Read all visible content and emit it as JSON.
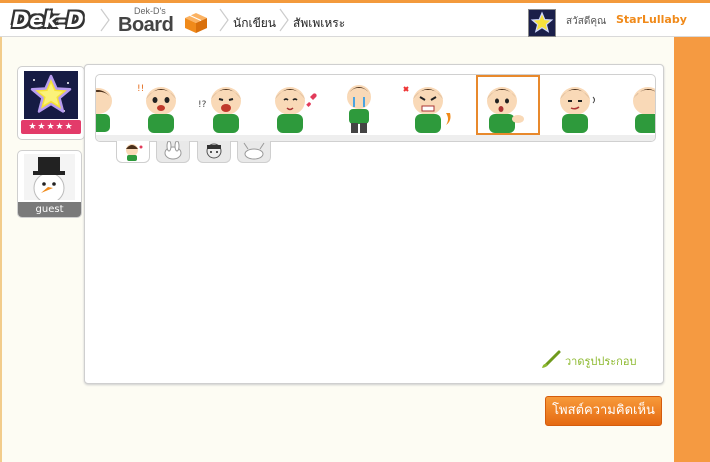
{
  "header": {
    "logo_text": "Dek-D",
    "board_logo_small": "Dek-D's",
    "board_logo_big": "Board",
    "nav_items": [
      "นักเขียน",
      "สัพเพเหระ"
    ],
    "greeting": "สวัสดีคุณ",
    "username": "StarLullaby"
  },
  "sidebar": {
    "user_stars": "★★★★★",
    "guest_label": "guest"
  },
  "editor": {
    "sticker_icons": [
      "boy-sticker-partial",
      "boy-scared-sticker",
      "boy-shouting-sticker",
      "boy-love-sticker",
      "boy-crying-sticker",
      "boy-angry-sticker",
      "boy-thinking-sticker",
      "boy-smirk-sticker",
      "boy-sticker-partial-right"
    ],
    "selected_sticker_index": 6,
    "sticker_sets": [
      "boy-set",
      "rabbit-set",
      "face-set",
      "bunny-set"
    ],
    "active_set_index": 0,
    "draw_label": "วาดรูปประกอบ"
  },
  "actions": {
    "post_button": "โพสต์ความคิดเห็น"
  },
  "colors": {
    "accent": "#f59a41",
    "username": "#f08a1a",
    "draw_link": "#8db92f",
    "selected_border": "#e8892c"
  }
}
